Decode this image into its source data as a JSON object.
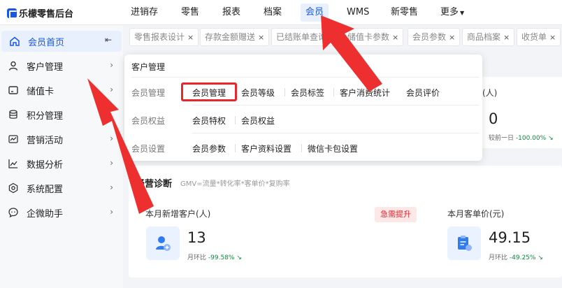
{
  "logo": {
    "text": "乐檬零售后台"
  },
  "nav": [
    "进销存",
    "零售",
    "报表",
    "档案",
    "会员",
    "WMS",
    "新零售",
    "更多"
  ],
  "sidebar": {
    "items": [
      {
        "label": "会员首页",
        "icon": "home-icon"
      },
      {
        "label": "客户管理",
        "icon": "user-icon"
      },
      {
        "label": "储值卡",
        "icon": "card-icon"
      },
      {
        "label": "积分管理",
        "icon": "coins-icon"
      },
      {
        "label": "营销活动",
        "icon": "activity-icon"
      },
      {
        "label": "数据分析",
        "icon": "chart-icon"
      },
      {
        "label": "系统配置",
        "icon": "settings-icon"
      },
      {
        "label": "企微助手",
        "icon": "chat-icon"
      }
    ]
  },
  "tabs": [
    "零售报表设计",
    "存款金额赠送",
    "已结账单查询",
    "储值卡参数",
    "会员参数",
    "商品档案",
    "收货单"
  ],
  "popup": {
    "title": "客户管理",
    "rows": [
      {
        "label": "会员管理",
        "items": [
          "会员管理",
          "会员等级",
          "会员标签",
          "客户消费统计",
          "会员评价"
        ]
      },
      {
        "label": "会员权益",
        "items": [
          "会员特权",
          "会员权益"
        ]
      },
      {
        "label": "会员设置",
        "items": [
          "会员参数",
          "客户资料设置",
          "微信卡包设置"
        ]
      }
    ]
  },
  "right_card": {
    "label_tail": "(人)",
    "value": "0",
    "compare_label": "较前一日",
    "compare_pct": "-100.00%"
  },
  "diagnosis": {
    "title": "经营诊断",
    "subtitle": "GMV=流量*转化率*客单价*复购率",
    "badge": "急需提升",
    "stats": [
      {
        "label": "本月新增客户(人)",
        "value": "13",
        "compare_label": "月环比",
        "compare_pct": "-99.58%"
      },
      {
        "label": "本月客单价(元)",
        "value": "49.15",
        "compare_label": "月环比",
        "compare_pct": "-49.25%"
      }
    ]
  },
  "colors": {
    "accent": "#1a56e8",
    "highlight": "#e8262b",
    "down_green": "#0a8a3a"
  }
}
